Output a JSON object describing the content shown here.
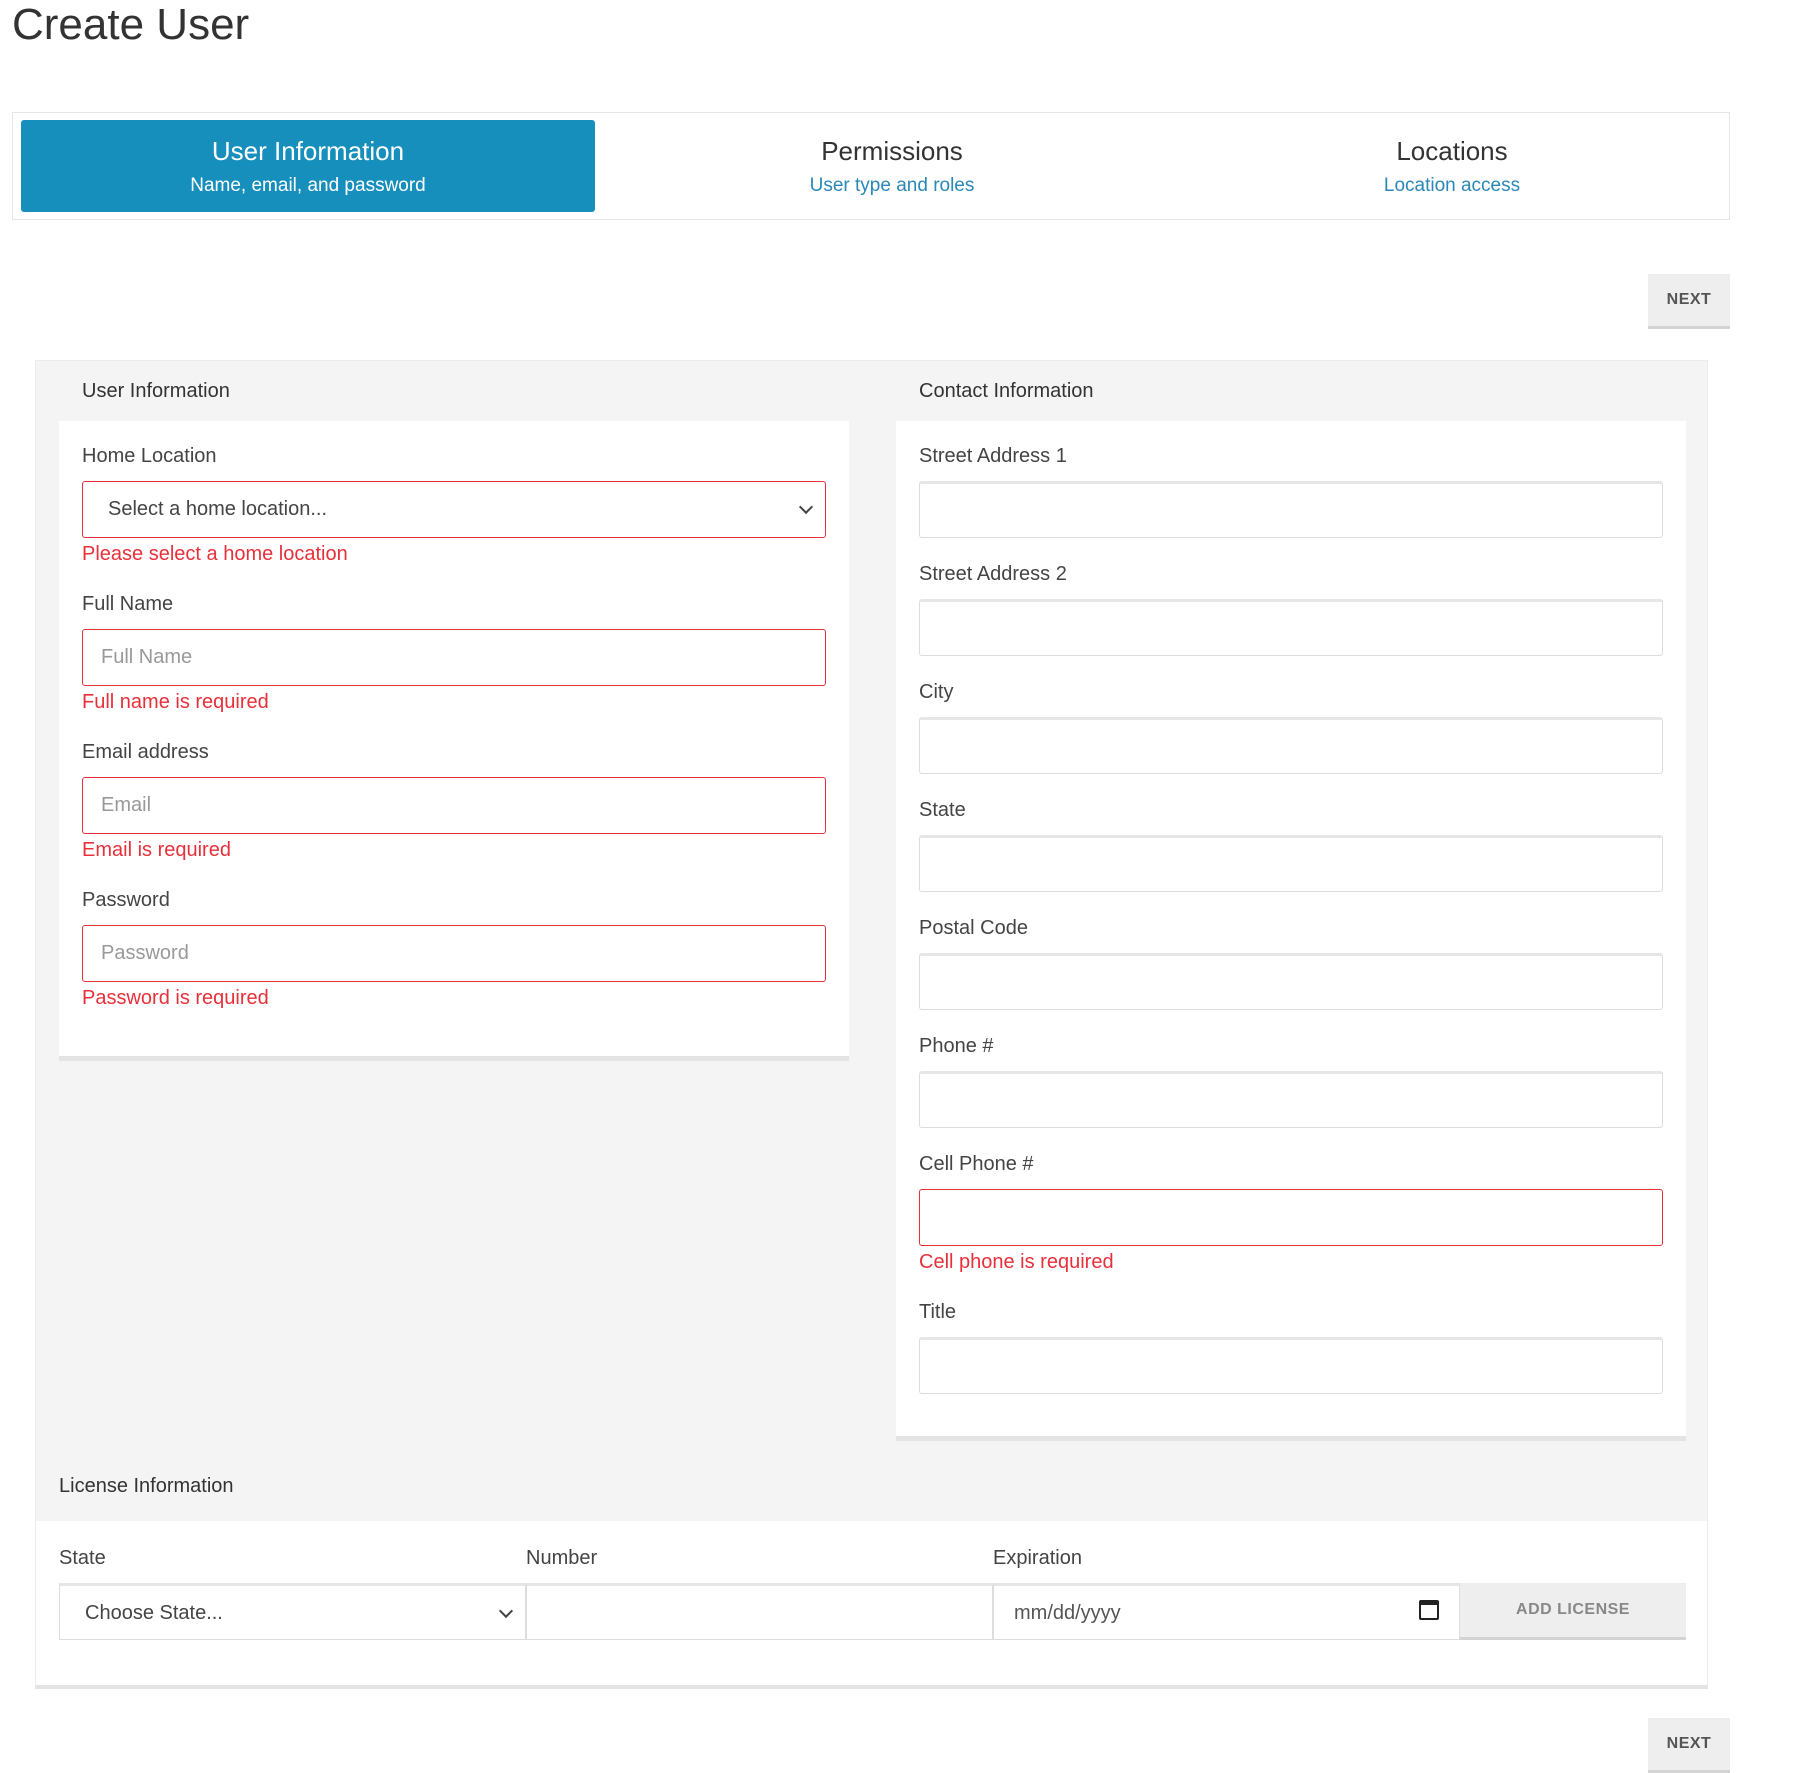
{
  "page": {
    "title": "Create User"
  },
  "stepper": {
    "steps": [
      {
        "title": "User Information",
        "subtitle": "Name, email, and password"
      },
      {
        "title": "Permissions",
        "subtitle": "User type and roles"
      },
      {
        "title": "Locations",
        "subtitle": "Location access"
      }
    ],
    "active_step": "User Information"
  },
  "actions": {
    "next_label": "NEXT"
  },
  "user_info": {
    "header": "User Information",
    "home_location": {
      "label": "Home Location",
      "value": "Select a home location...",
      "error": "Please select a home location"
    },
    "full_name": {
      "label": "Full Name",
      "placeholder": "Full Name",
      "error": "Full name is required"
    },
    "email": {
      "label": "Email address",
      "placeholder": "Email",
      "error": "Email is required"
    },
    "password": {
      "label": "Password",
      "placeholder": "Password",
      "error": "Password is required"
    }
  },
  "contact_info": {
    "header": "Contact Information",
    "street1": {
      "label": "Street Address 1"
    },
    "street2": {
      "label": "Street Address 2"
    },
    "city": {
      "label": "City"
    },
    "state": {
      "label": "State"
    },
    "postal": {
      "label": "Postal Code"
    },
    "phone": {
      "label": "Phone #"
    },
    "cell": {
      "label": "Cell Phone #",
      "error": "Cell phone is required"
    },
    "title": {
      "label": "Title"
    }
  },
  "license": {
    "header": "License Information",
    "state": {
      "label": "State",
      "value": "Choose State..."
    },
    "number": {
      "label": "Number"
    },
    "expiration": {
      "label": "Expiration",
      "placeholder": "mm/dd/yyyy"
    },
    "add_label": "ADD LICENSE"
  },
  "colors": {
    "accent": "#178fbd",
    "error": "#e8303a",
    "link": "#2a88b8"
  }
}
